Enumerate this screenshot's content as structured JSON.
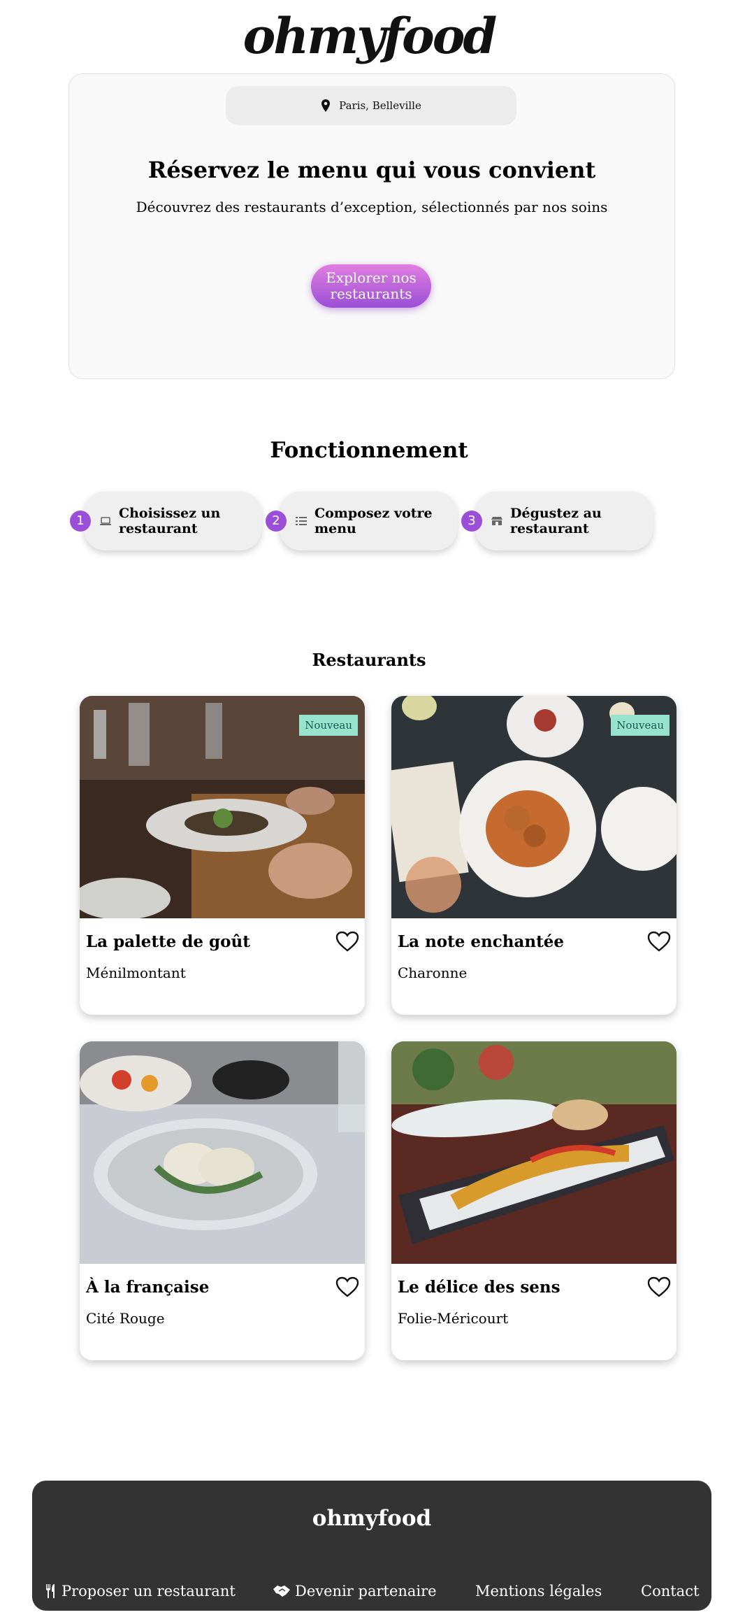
{
  "brand": {
    "logo": "ohmyfood"
  },
  "hero": {
    "location": "Paris, Belleville",
    "title": "Réservez le menu qui vous convient",
    "subtitle": "Découvrez des restaurants d’exception, sélectionnés par nos soins",
    "cta_label": "Explorer nos restaurants"
  },
  "how": {
    "title": "Fonctionnement",
    "steps": [
      {
        "number": "1",
        "icon": "laptop-icon",
        "label": "Choisissez un restaurant"
      },
      {
        "number": "2",
        "icon": "list-icon",
        "label": "Composez votre menu"
      },
      {
        "number": "3",
        "icon": "store-icon",
        "label": "Dégustez au restaurant"
      }
    ]
  },
  "restaurants": {
    "title": "Restaurants",
    "items": [
      {
        "name": "La palette de goût",
        "area": "Ménilmontant",
        "badge": "Nouveau"
      },
      {
        "name": "La note enchantée",
        "area": "Charonne",
        "badge": "Nouveau"
      },
      {
        "name": "À la française",
        "area": "Cité Rouge"
      },
      {
        "name": "Le délice des sens",
        "area": "Folie-Méricourt"
      }
    ]
  },
  "footer": {
    "logo": "ohmyfood",
    "links": [
      {
        "label": "Proposer un restaurant",
        "icon": "utensils-icon"
      },
      {
        "label": "Devenir partenaire",
        "icon": "handshake-icon"
      },
      {
        "label": "Mentions légales"
      },
      {
        "label": "Contact"
      }
    ]
  },
  "colors": {
    "accent_purple": "#9b4fd8",
    "cta_pink": "#e07ee0",
    "badge_mint": "#98e3cc",
    "footer_bg": "#333333"
  }
}
